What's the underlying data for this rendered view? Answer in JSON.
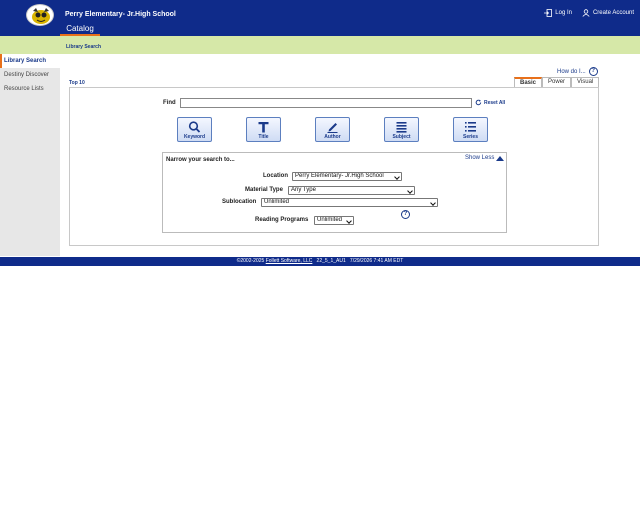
{
  "header": {
    "school_name": "Perry Elementary- Jr.High School",
    "catalog_tab": "Catalog",
    "login_label": "Log In",
    "create_account_label": "Create Account"
  },
  "subheader": {
    "title": "Library Search"
  },
  "sidebar": {
    "items": [
      {
        "label": "Library Search",
        "active": true
      },
      {
        "label": "Destiny Discover",
        "active": false
      },
      {
        "label": "Resource Lists",
        "active": false
      }
    ]
  },
  "main": {
    "how_do_i": "How do I...",
    "top10": "Top 10",
    "mode_tabs": [
      "Basic",
      "Power",
      "Visual"
    ],
    "find_label": "Find",
    "find_value": "",
    "reset_label": "Reset All",
    "search_types": [
      "Keyword",
      "Title",
      "Author",
      "Subject",
      "Series"
    ],
    "narrow": {
      "title": "Narrow your search to...",
      "show_less": "Show Less",
      "location_label": "Location",
      "location_value": "Perry Elementary- Jr.High School",
      "material_label": "Material Type",
      "material_value": "Any Type",
      "sublocation_label": "Sublocation",
      "sublocation_value": "Unlimited",
      "reading_label": "Reading Programs",
      "reading_value": "Unlimited"
    }
  },
  "footer": {
    "copyright": "©2002-2025",
    "company": "Follett Software, LLC",
    "version": "22_5_1_AU1",
    "timestamp": "7/29/2026 7:41 AM EDT"
  },
  "colors": {
    "header_blue": "#0f2b8a",
    "accent_orange": "#e8701a",
    "subheader_green": "#d6e8a8"
  }
}
